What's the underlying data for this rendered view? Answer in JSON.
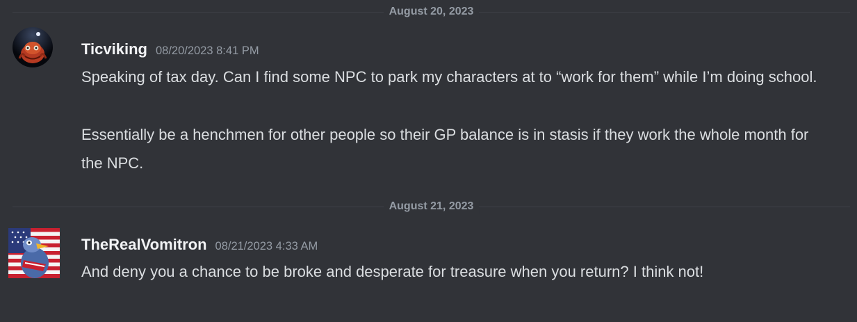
{
  "dividers": [
    {
      "label": "August 20, 2023"
    },
    {
      "label": "August 21, 2023"
    }
  ],
  "messages": [
    {
      "username": "Ticviking",
      "timestamp": "08/20/2023 8:41 PM",
      "avatar_icon": "red-furry-muppet-avatar",
      "paragraphs": [
        "Speaking of tax day. Can I find some NPC to park my characters at to “work for them” while I’m doing school.",
        "Essentially be a henchmen for other people so their GP balance is in stasis if they work the whole month for the NPC."
      ]
    },
    {
      "username": "TheRealVomitron",
      "timestamp": "08/21/2023 4:33 AM",
      "avatar_icon": "eagle-with-us-flag-avatar",
      "paragraphs": [
        "And deny you a chance to be broke and desperate for treasure when you return? I think not!"
      ]
    }
  ],
  "colors": {
    "background": "#313338",
    "username": "#f2f3f5",
    "message_text": "#dbdee1",
    "muted": "#949ba4",
    "divider_line": "#3f4147"
  }
}
